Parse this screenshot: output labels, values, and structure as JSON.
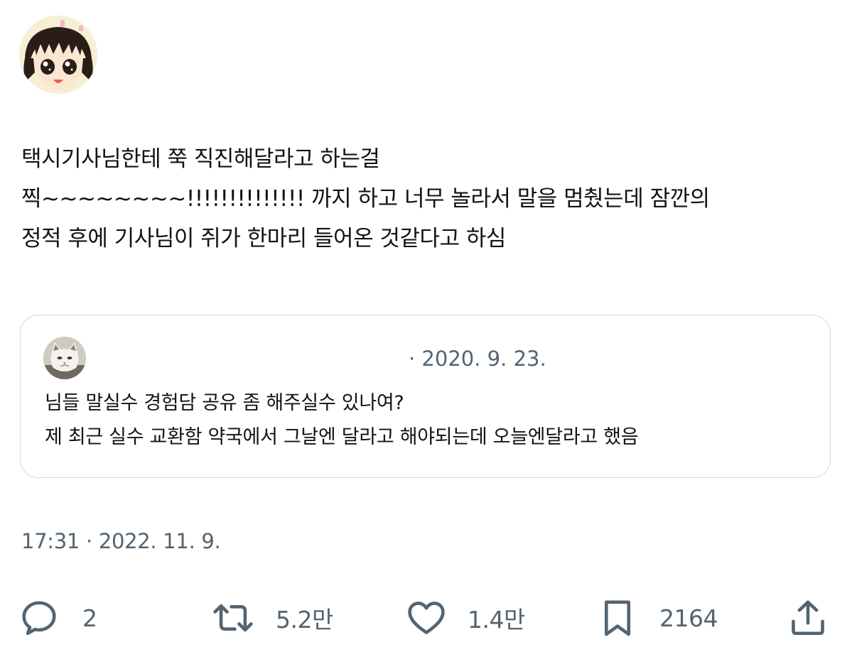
{
  "tweet": {
    "lines": [
      "택시기사님한테 쭉 직진해달라고 하는걸",
      "찍~~~~~~~~!!!!!!!!!!!!!! 까지 하고 너무 놀라서 말을 멈췄는데 잠깐의",
      "정적 후에 기사님이 쥐가 한마리 들어온 것같다고 하심"
    ],
    "timestamp": "17:31 · 2022. 11. 9."
  },
  "quote": {
    "date": "· 2020. 9. 23.",
    "lines": [
      "님들 말실수 경험담 공유 좀 해주실수 있나여?",
      "제 최근 실수 교환함 약국에서 그날엔 달라고 해야되는데 오늘엔달라고 했음"
    ]
  },
  "actions": {
    "reply": {
      "icon": "reply-icon",
      "count": "2"
    },
    "retweet": {
      "icon": "retweet-icon",
      "count": "5.2만"
    },
    "like": {
      "icon": "heart-icon",
      "count": "1.4만"
    },
    "bookmark": {
      "icon": "bookmark-icon",
      "count": "2164"
    },
    "share": {
      "icon": "share-icon"
    }
  },
  "colors": {
    "text": "#0f1419",
    "secondary": "#536471",
    "border": "#cfd9de"
  }
}
